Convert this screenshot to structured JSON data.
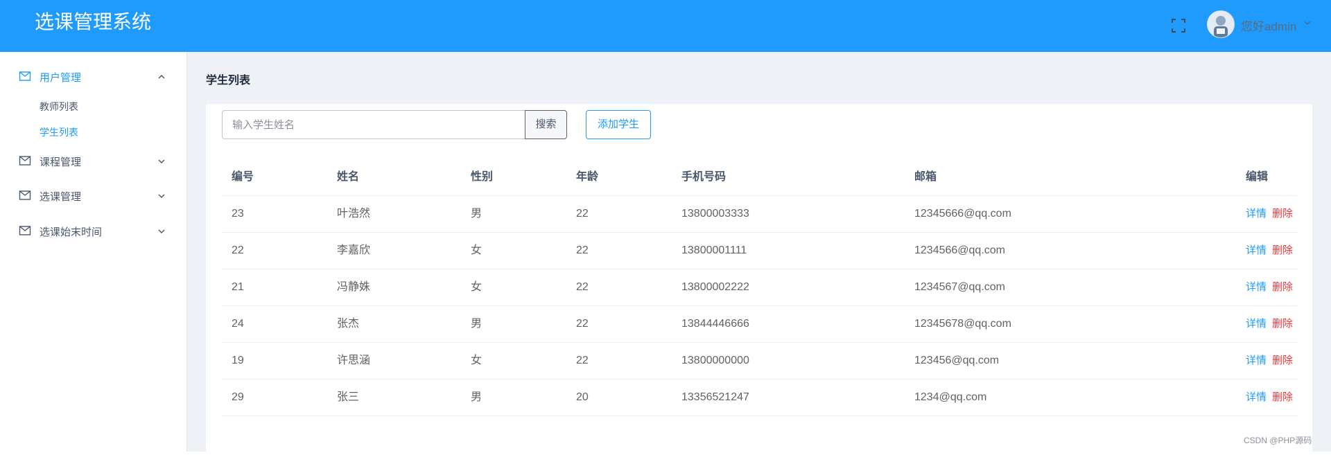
{
  "header": {
    "app_title": "选课管理系统",
    "user_greeting": "您好admin",
    "accent_color": "#1e9bfd",
    "icons": [
      "fullscreen-icon",
      "avatar",
      "chevron-down-icon"
    ]
  },
  "sidebar": {
    "groups": [
      {
        "label": "用户管理",
        "icon": "mail-icon",
        "expanded": true,
        "active": true,
        "children": [
          {
            "label": "教师列表",
            "active": false
          },
          {
            "label": "学生列表",
            "active": true
          }
        ]
      },
      {
        "label": "课程管理",
        "icon": "mail-icon",
        "expanded": false
      },
      {
        "label": "选课管理",
        "icon": "mail-icon",
        "expanded": false
      },
      {
        "label": "选课始末时间",
        "icon": "mail-icon",
        "expanded": false
      }
    ]
  },
  "main": {
    "page_title": "学生列表",
    "search": {
      "placeholder": "输入学生姓名",
      "value": "",
      "button_label": "搜索"
    },
    "add_button_label": "添加学生",
    "table": {
      "headers": [
        "编号",
        "姓名",
        "性别",
        "年龄",
        "手机号码",
        "邮箱",
        "编辑"
      ],
      "detail_label": "详情",
      "delete_label": "删除",
      "rows": [
        {
          "id": "23",
          "name": "叶浩然",
          "gender": "男",
          "age": "22",
          "phone": "13800003333",
          "email": "12345666@qq.com"
        },
        {
          "id": "22",
          "name": "李嘉欣",
          "gender": "女",
          "age": "22",
          "phone": "13800001111",
          "email": "1234566@qq.com"
        },
        {
          "id": "21",
          "name": "冯静姝",
          "gender": "女",
          "age": "22",
          "phone": "13800002222",
          "email": "1234567@qq.com"
        },
        {
          "id": "24",
          "name": "张杰",
          "gender": "男",
          "age": "22",
          "phone": "13844446666",
          "email": "12345678@qq.com"
        },
        {
          "id": "19",
          "name": "许思涵",
          "gender": "女",
          "age": "22",
          "phone": "13800000000",
          "email": "123456@qq.com"
        },
        {
          "id": "29",
          "name": "张三",
          "gender": "男",
          "age": "20",
          "phone": "13356521247",
          "email": "1234@qq.com"
        }
      ]
    }
  },
  "watermark": "CSDN @PHP源码"
}
